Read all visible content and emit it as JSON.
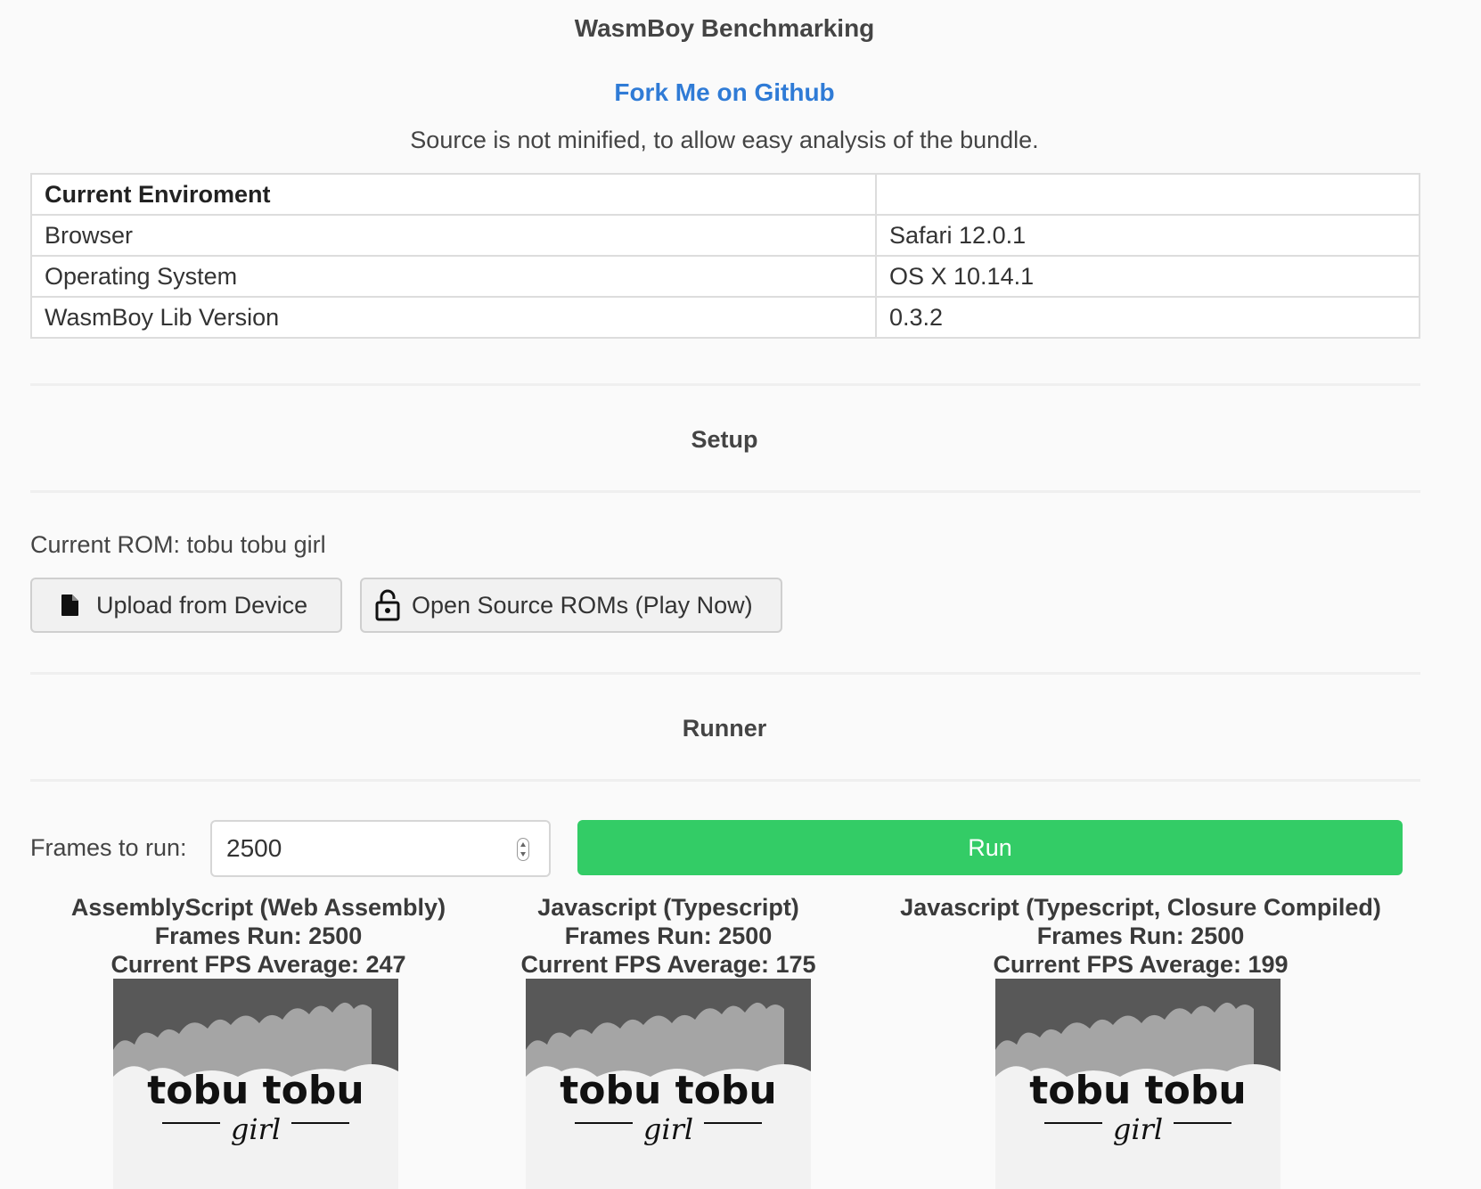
{
  "header": {
    "title": "WasmBoy Benchmarking",
    "fork_link": "Fork Me on Github",
    "note": "Source is not minified, to allow easy analysis of the bundle."
  },
  "environment": {
    "heading": "Current Enviroment",
    "rows": [
      {
        "label": "Browser",
        "value": "Safari 12.0.1"
      },
      {
        "label": "Operating System",
        "value": "OS X 10.14.1"
      },
      {
        "label": "WasmBoy Lib Version",
        "value": "0.3.2"
      }
    ]
  },
  "setup": {
    "heading": "Setup",
    "current_rom": "Current ROM: tobu tobu girl",
    "upload_button": "Upload from Device",
    "upload_icon": "file-icon",
    "open_source_button": "Open Source ROMs (Play Now)",
    "open_source_icon": "unlock-icon"
  },
  "runner": {
    "heading": "Runner",
    "frames_label": "Frames to run:",
    "frames_value": "2500",
    "run_button": "Run",
    "run_color": "#33cc66",
    "results": [
      {
        "name": "AssemblyScript (Web Assembly)",
        "frames": "Frames Run: 2500",
        "fps": "Current FPS Average: 247",
        "game_title": "tobu tobu",
        "game_subtitle": "girl"
      },
      {
        "name": "Javascript (Typescript)",
        "frames": "Frames Run: 2500",
        "fps": "Current FPS Average: 175",
        "game_title": "tobu tobu",
        "game_subtitle": "girl"
      },
      {
        "name": "Javascript (Typescript, Closure Compiled)",
        "frames": "Frames Run: 2500",
        "fps": "Current FPS Average: 199",
        "game_title": "tobu tobu",
        "game_subtitle": "girl"
      }
    ]
  }
}
